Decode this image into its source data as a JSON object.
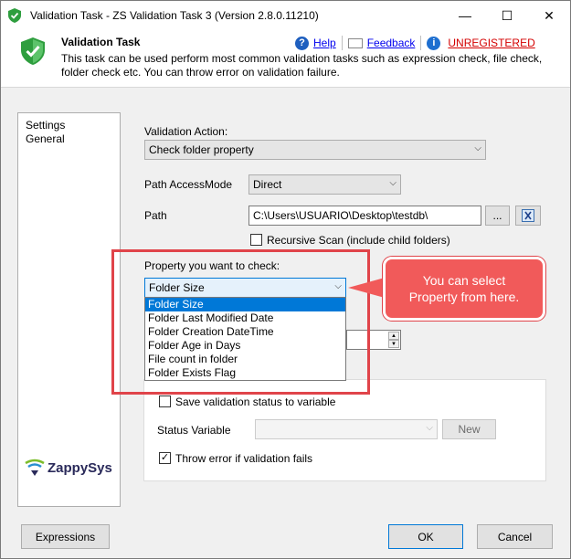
{
  "window": {
    "title": "Validation Task - ZS Validation Task 3 (Version 2.8.0.11210)",
    "minimize": "—",
    "maximize": "☐",
    "close": "✕"
  },
  "header": {
    "task_title": "Validation Task",
    "description": "This task can be used perform most common validation tasks such as expression check, file check, folder check etc. You can throw error on validation failure.",
    "help_label": "Help",
    "feedback_label": "Feedback",
    "unregistered_label": "UNREGISTERED"
  },
  "nav": {
    "items": [
      "Settings",
      "General"
    ]
  },
  "logo": {
    "text": "ZappySys"
  },
  "form": {
    "validation_action_label": "Validation Action:",
    "validation_action_value": "Check folder property",
    "path_access_mode_label": "Path AccessMode",
    "path_access_mode_value": "Direct",
    "path_label": "Path",
    "path_value": "C:\\Users\\USUARIO\\Desktop\\testdb\\",
    "browse_label": "...",
    "recursive_label": "Recursive Scan (include child folders)",
    "recursive_checked": false,
    "property_label": "Property you want to check:",
    "property_value": "Folder Size",
    "property_options": [
      "Folder Size",
      "Folder Last Modified Date",
      "Folder Creation DateTime",
      "Folder Age in Days",
      "File count in folder",
      "Folder Exists Flag"
    ],
    "selected_option_index": 0,
    "save_status_label": "Save validation status to variable",
    "save_status_checked": false,
    "status_variable_label": "Status Variable",
    "status_variable_value": "",
    "new_label": "New",
    "throw_error_label": "Throw error if validation fails",
    "throw_error_checked": true
  },
  "callout": {
    "line1": "You can select",
    "line2": "Property from here."
  },
  "footer": {
    "expressions_label": "Expressions",
    "ok_label": "OK",
    "cancel_label": "Cancel"
  },
  "colors": {
    "accent": "#0078d7",
    "callout_red": "#f15a5a",
    "highlight_border": "#e0444a",
    "link": "#0000ee",
    "unregistered": "#d40000"
  }
}
